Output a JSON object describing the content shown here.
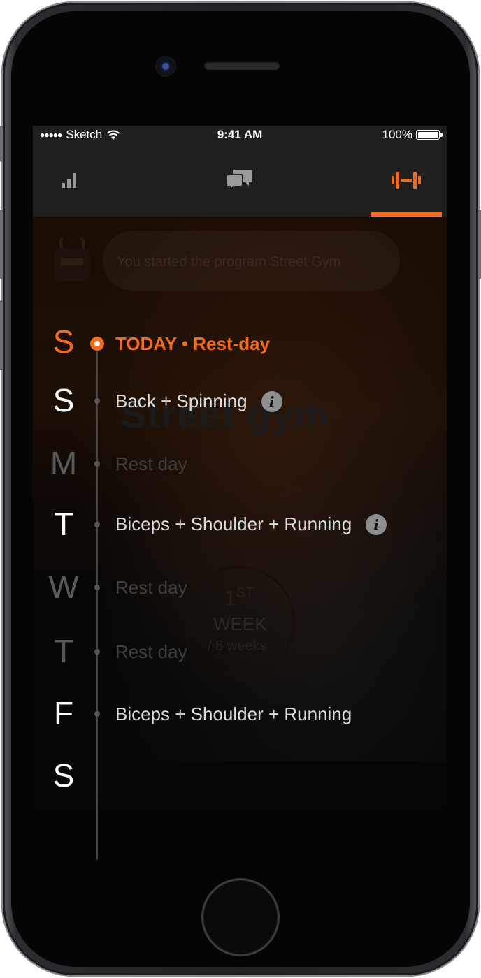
{
  "statusbar": {
    "signal": "●●●●●",
    "carrier": "Sketch",
    "time": "9:41 AM",
    "battery": "100%"
  },
  "tabs": [
    {
      "name": "stats",
      "icon": "bar-chart-icon",
      "active": false
    },
    {
      "name": "chat",
      "icon": "chat-bubbles-icon",
      "active": false
    },
    {
      "name": "workouts",
      "icon": "dumbbell-icon",
      "active": true
    }
  ],
  "colors": {
    "accent": "#f26a1b",
    "background": "#000000",
    "tabbar": "#1f1f1f"
  },
  "background": {
    "notification": "You started the program Street Gym",
    "title": "Street gym",
    "week_number": "1",
    "week_suffix": "ST",
    "week_label": "WEEK",
    "week_total": "/ 8 weeks"
  },
  "days": [
    {
      "letter": "S",
      "workout": "TODAY • Rest-day",
      "state": "today",
      "info": false
    },
    {
      "letter": "S",
      "workout": "Back + Spinning",
      "state": "normal",
      "info": true
    },
    {
      "letter": "M",
      "workout": "Rest day",
      "state": "dim",
      "info": false
    },
    {
      "letter": "T",
      "workout": "Biceps + Shoulder + Running",
      "state": "normal",
      "info": true
    },
    {
      "letter": "W",
      "workout": "Rest day",
      "state": "dim",
      "info": false
    },
    {
      "letter": "T",
      "workout": "Rest day",
      "state": "dim",
      "info": false
    },
    {
      "letter": "F",
      "workout": "Biceps + Shoulder + Running",
      "state": "normal",
      "info": false
    },
    {
      "letter": "S",
      "workout": "",
      "state": "normal",
      "info": false
    }
  ]
}
